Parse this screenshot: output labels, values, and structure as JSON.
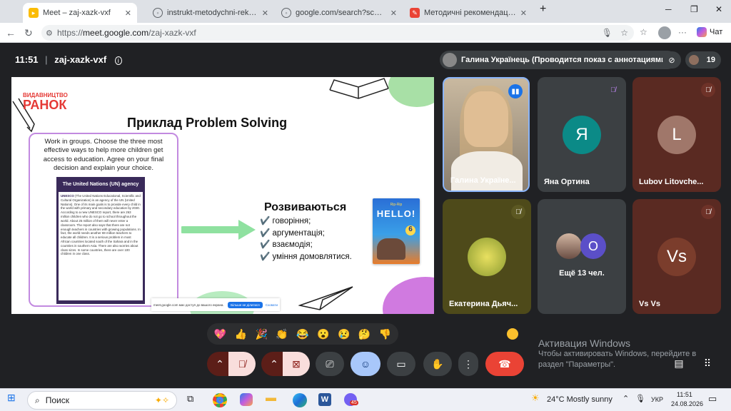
{
  "browser": {
    "tabs": [
      {
        "label": "Meet – zaj-xazk-vxf",
        "active": true
      },
      {
        "label": "instrukt-metodychni-rekomend.p"
      },
      {
        "label": "google.com/search?sca_esv=7e6a"
      },
      {
        "label": "Методичні рекомендації щодо в"
      }
    ],
    "new_tab": "+",
    "url_scheme": "https://",
    "url_host": "meet.google.com",
    "url_path": "/zaj-xazk-vxf",
    "chat_label": "Чат"
  },
  "meet": {
    "time": "11:51",
    "separator": "|",
    "meeting_code": "zaj-xazk-vxf",
    "presenter_label": "Галина Українець (Проводится показ с аннотациями).",
    "participant_count": "19",
    "tiles": [
      {
        "name": "Галина Українe...",
        "kind": "video"
      },
      {
        "name": "Яна Ортина",
        "initial": "Я",
        "color": "#0b8a87"
      },
      {
        "name": "Lubov Litovche...",
        "initial": "L",
        "color": "#a0776a"
      },
      {
        "name": "Екатерина Дьяч...",
        "kind": "photo"
      },
      {
        "name": "Ещё 13 чел.",
        "initial": "О"
      },
      {
        "name": "Vs Vs",
        "initial": "Vs",
        "color": "#7b3d2c"
      }
    ],
    "reactions": [
      "💖",
      "👍",
      "🎉",
      "👏",
      "😂",
      "😮",
      "😢",
      "🤔",
      "👎"
    ]
  },
  "slide": {
    "publisher_top": "ВИДАВНИЦТВО",
    "publisher_main": "РАНОК",
    "title": "Приклад Problem Solving",
    "task": "Work in groups. Choose the three most effective ways to help more children get access to education. Agree on your final decision and explain your choice.",
    "article_header": "The United Nations (UN) agency",
    "article_lead": "UNESCO",
    "article_body": "(The United Nations Educational, Scientific and Cultural Organization) is an agency of the UN (United Nations). One of its main goals is to provide every child in the world with primary and secondary education by 2030. According to a new UNESCO report, there are 263 million children who do not go to school throughout the world. About 25 million of them will never enter a classroom. The report also says that there are not enough teachers in countries with growing populations. In fact, the world needs another 69 million teachers to educate all children. It is a serious problem in most African countries located south of the Sahara and in the countries in southern Asia. There are also worries about class sizes. In some countries, there are over 100 children in one class.",
    "skills_title": "Розвиваються",
    "skills": [
      "✔️ говоріння;",
      "✔️ аргументація;",
      "✔️ взаємодія;",
      "✔️ уміння домовлятися."
    ],
    "book_title": "HELLO!",
    "book_top": "Rip-Rip",
    "book_number": "6",
    "share_notice": "meet.google.com має доступ до вашого екрана.",
    "share_stop": "Більше не ділитися",
    "share_hide": "Сховати"
  },
  "windows": {
    "activation_title": "Активация Windows",
    "activation_text": "Чтобы активировать Windows, перейдите в раздел \"Параметры\"."
  },
  "taskbar": {
    "search": "Поиск",
    "weather": "24°C  Mostly sunny",
    "lang": "УКР",
    "clock": "11:51",
    "date": "24.08.2026",
    "badge": "45"
  },
  "colors": {
    "end_call": "#ea4335",
    "accent": "#8ab4f8",
    "dark": "#202124"
  }
}
